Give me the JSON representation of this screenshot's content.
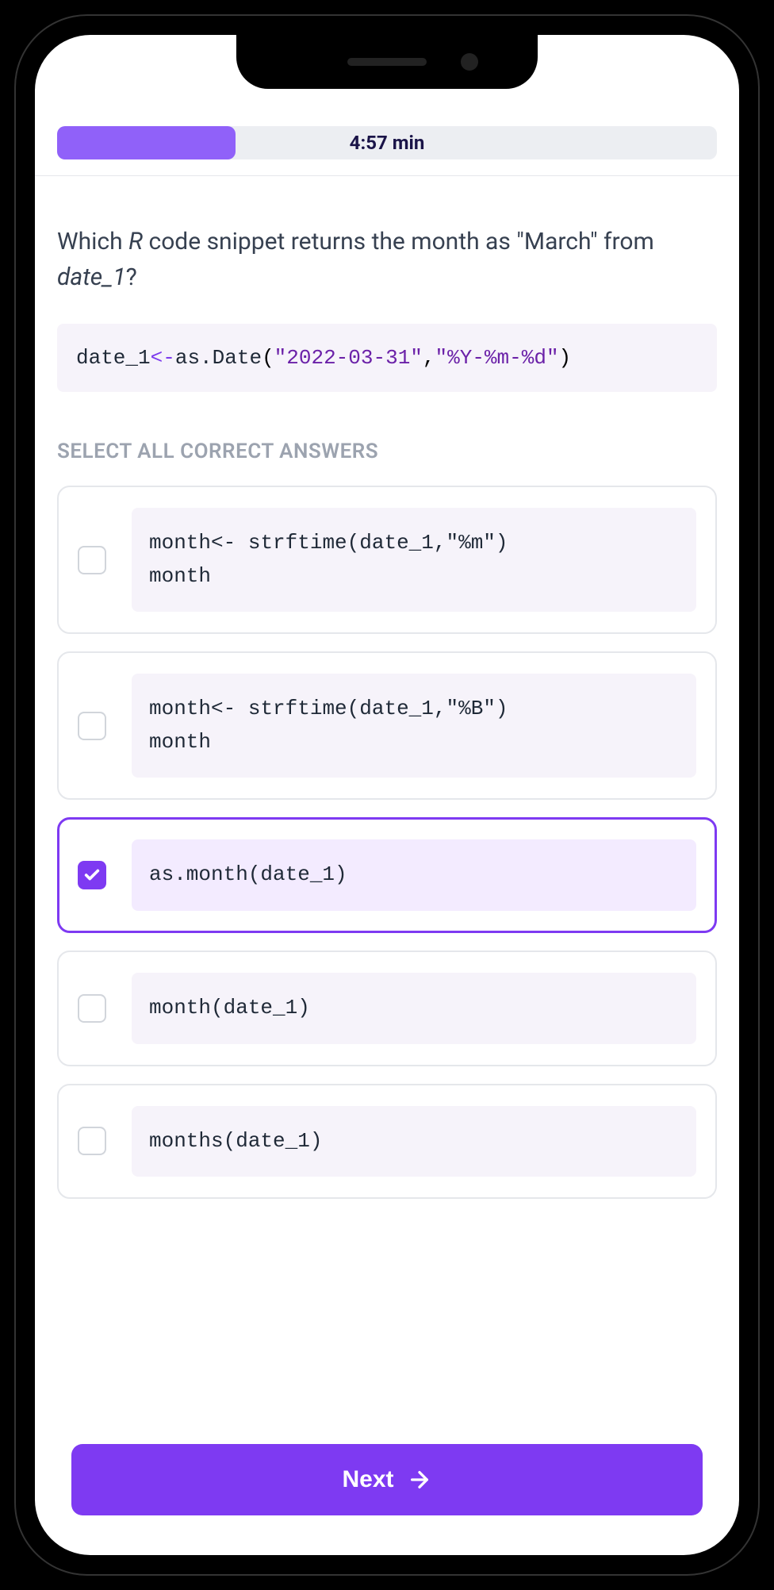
{
  "progress": {
    "timer": "4:57 min",
    "percent": 27
  },
  "question": {
    "prefix": "Which ",
    "lang": "R",
    "mid": " code snippet returns the month as \"March\" from ",
    "var": "date_1",
    "suffix": "?"
  },
  "code_sample": {
    "var": "date_1",
    "op": "<-",
    "fn": "as.Date",
    "arg1": "\"2022-03-31\"",
    "comma": ",",
    "arg2": "\"%Y-%m-%d\""
  },
  "instruction": "SELECT ALL CORRECT ANSWERS",
  "answers": [
    {
      "code_html": "month<span class='op'>&lt;-</span> strftime(date_1,<span class='str'>\"%m\"</span>)\nmonth",
      "selected": false
    },
    {
      "code_html": "month<span class='op'>&lt;-</span> strftime(date_1,<span class='str'>\"%B\"</span>)\nmonth",
      "selected": false
    },
    {
      "code_html": "as.month(date_1)",
      "selected": true
    },
    {
      "code_html": "month(date_1)",
      "selected": false
    },
    {
      "code_html": "months(date_1)",
      "selected": false
    }
  ],
  "next_button": "Next"
}
